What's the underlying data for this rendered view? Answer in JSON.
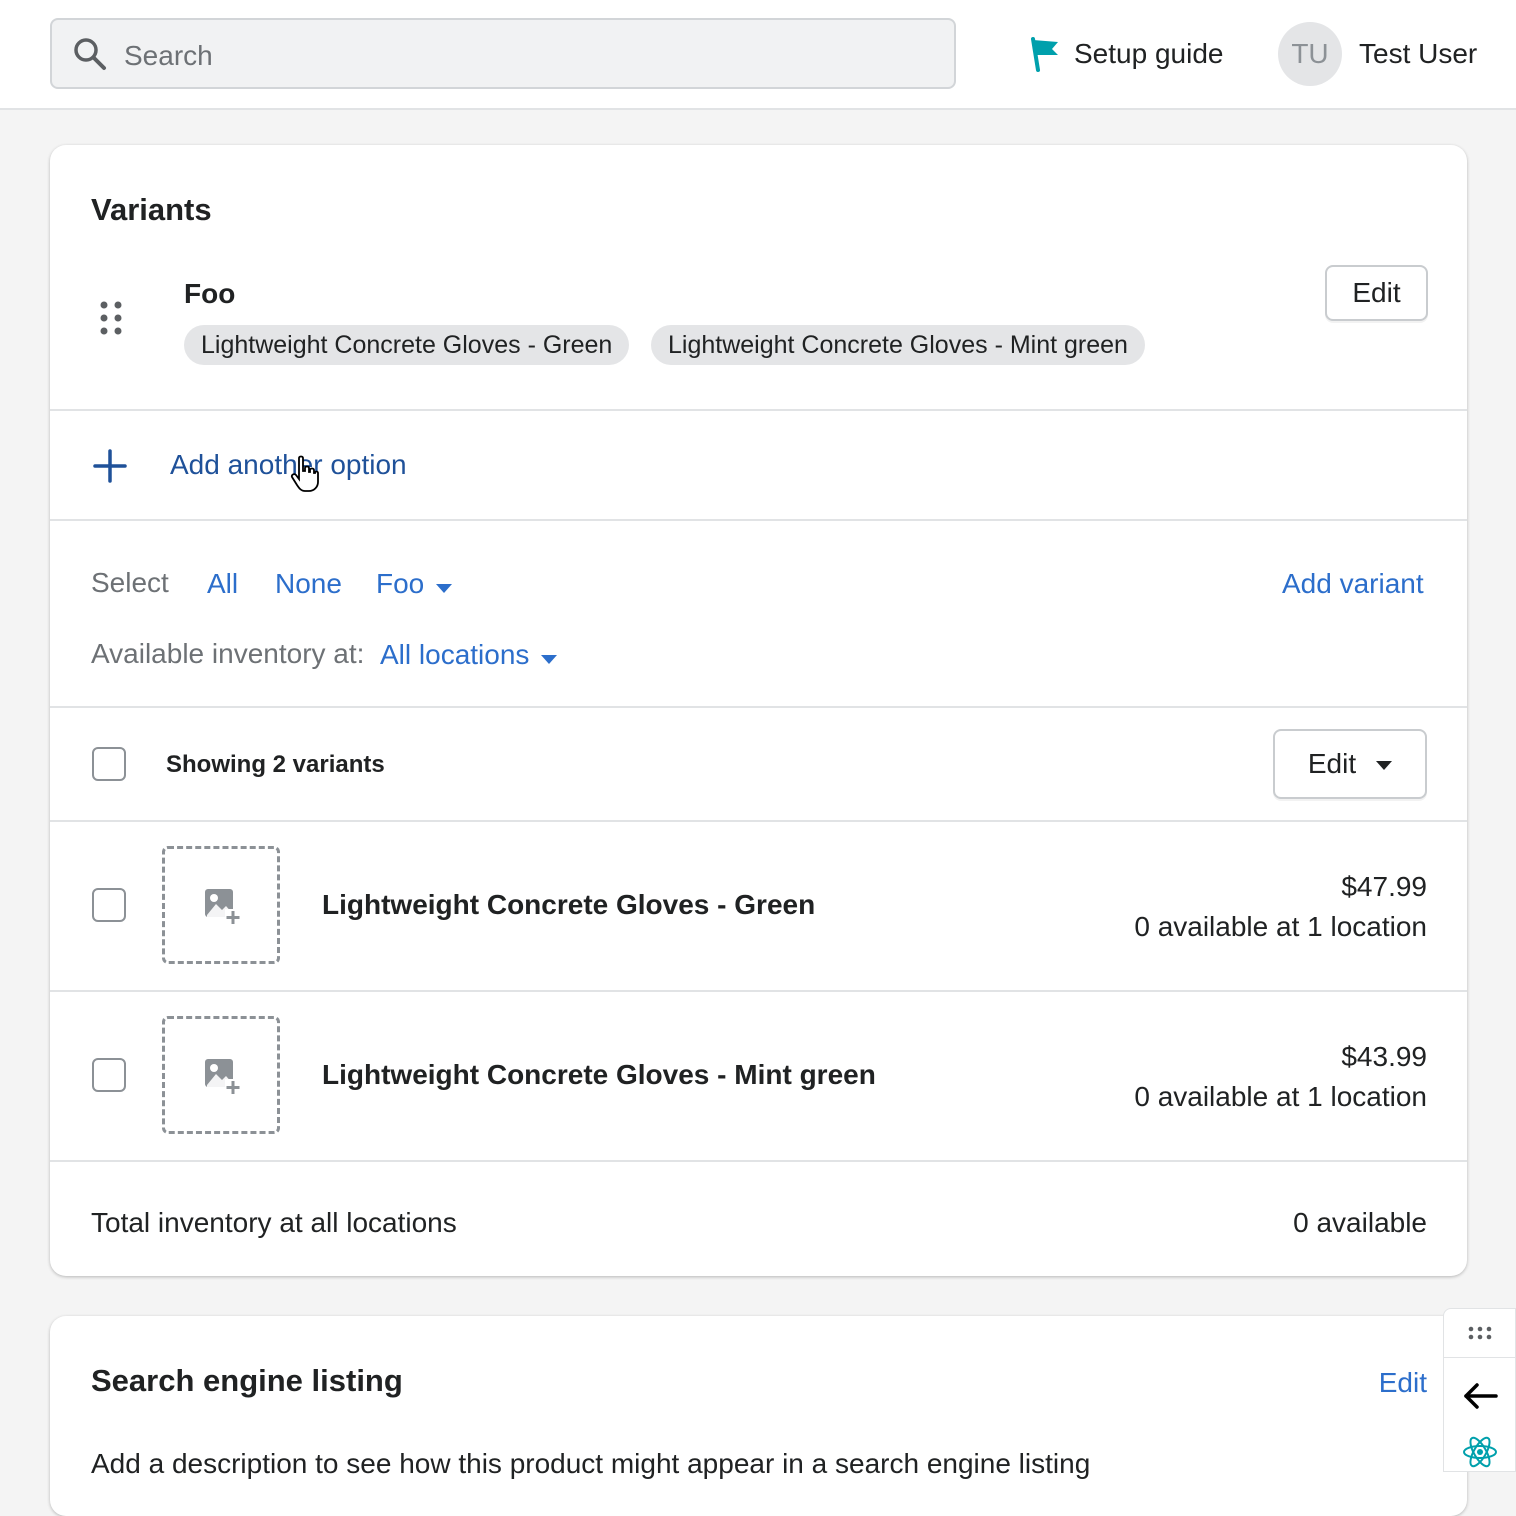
{
  "topbar": {
    "search_placeholder": "Search",
    "setup_guide": "Setup guide",
    "avatar_initials": "TU",
    "user_name": "Test User"
  },
  "variants_card": {
    "title": "Variants",
    "option": {
      "name": "Foo",
      "edit_label": "Edit",
      "values": [
        "Lightweight Concrete Gloves - Green",
        "Lightweight Concrete Gloves - Mint green"
      ]
    },
    "add_option_label": "Add another option",
    "select": {
      "label": "Select",
      "all": "All",
      "none": "None",
      "foo": "Foo",
      "add_variant": "Add variant"
    },
    "inventory_filter": {
      "label": "Available inventory at:",
      "value": "All locations"
    },
    "list_header": {
      "showing": "Showing 2 variants",
      "edit_label": "Edit"
    },
    "rows": [
      {
        "name": "Lightweight Concrete Gloves - Green",
        "price": "$47.99",
        "availability": "0 available at 1 location"
      },
      {
        "name": "Lightweight Concrete Gloves - Mint green",
        "price": "$43.99",
        "availability": "0 available at 1 location"
      }
    ],
    "total": {
      "label": "Total inventory at all locations",
      "value": "0 available"
    }
  },
  "seo_card": {
    "title": "Search engine listing",
    "edit_label": "Edit",
    "description": "Add a description to see how this product might appear in a search engine listing"
  },
  "colors": {
    "link": "#2c6ecb",
    "flag": "#00a0ac",
    "pill_bg": "#e4e5e7"
  }
}
